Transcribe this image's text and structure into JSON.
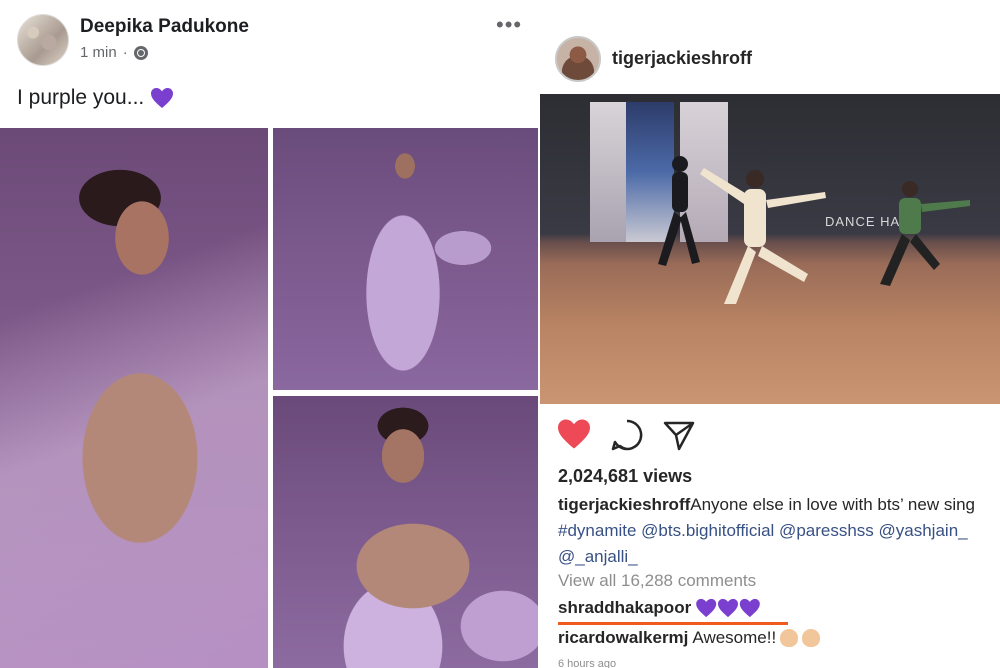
{
  "facebook": {
    "author": "Deepika Padukone",
    "time": "1 min",
    "separator": "·",
    "more": "•••",
    "post_text": "I purple you...",
    "emoji": "purple-heart"
  },
  "instagram": {
    "username": "tigerjackieshroff",
    "video_wall_text": "DANCE HALL",
    "views": "2,024,681 views",
    "caption": {
      "user": "tigerjackieshroff",
      "text": "Anyone else in love with bts’ new sing",
      "tags_line1": "#dynamite @bts.bighitofficial @paresshss @yashjain_",
      "tags_line2": "@_anjalli_"
    },
    "view_all": "View all 16,288 comments",
    "comments": [
      {
        "user": "shraddhakapoor",
        "text": ""
      },
      {
        "user": "ricardowalkermj",
        "text": "Awesome!!"
      }
    ],
    "time": "6 hours ago"
  },
  "colors": {
    "like_red": "#ed4956",
    "purple_heart": "#7b3fd0",
    "underline_orange": "#f05a1a",
    "link_blue": "#385185"
  }
}
